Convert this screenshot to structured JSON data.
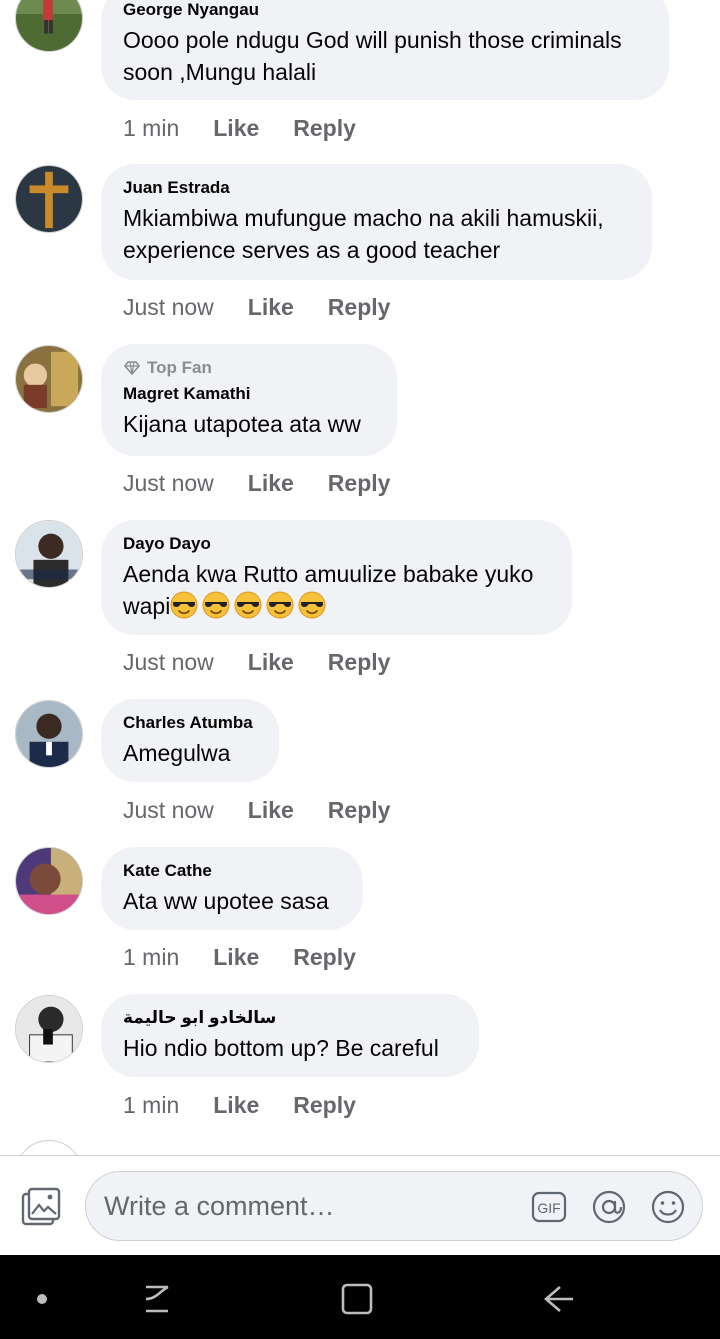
{
  "comments": [
    {
      "name": "George Nyangau",
      "lines": [
        "Oooo pole ndugu God will punish those criminals",
        "soon ,Mungu halali"
      ],
      "time": "1 min",
      "like": "Like",
      "reply": "Reply"
    },
    {
      "name": "Juan Estrada",
      "lines": [
        "Mkiambiwa mufungue macho na akili hamuskii,",
        "experience serves as a good teacher"
      ],
      "time": "Just now",
      "like": "Like",
      "reply": "Reply"
    },
    {
      "badge": "Top Fan",
      "name": "Magret Kamathi",
      "lines": [
        "Kijana utapotea ata ww"
      ],
      "time": "Just now",
      "like": "Like",
      "reply": "Reply"
    },
    {
      "name": "Dayo Dayo",
      "lines": [
        "Aenda kwa Rutto amuulize babake yuko",
        "wapi"
      ],
      "emoji_count": 5,
      "emoji": "smiling-face-with-sunglasses",
      "time": "Just now",
      "like": "Like",
      "reply": "Reply"
    },
    {
      "name": "Charles Atumba",
      "lines": [
        "Amegulwa"
      ],
      "time": "Just now",
      "like": "Like",
      "reply": "Reply"
    },
    {
      "name": "Kate Cathe",
      "lines": [
        "Ata ww upotee sasa"
      ],
      "time": "1 min",
      "like": "Like",
      "reply": "Reply"
    },
    {
      "name": "سالخادو ابو حاليمة",
      "lines": [
        "Hio ndio bottom up? Be careful"
      ],
      "time": "1 min",
      "like": "Like",
      "reply": "Reply"
    }
  ],
  "composer": {
    "placeholder": "Write a comment…",
    "icons": [
      "photo-icon",
      "gif-icon",
      "mention-icon",
      "emoji-icon"
    ],
    "gif_label": "GIF"
  },
  "navbar": {
    "icons": [
      "dot-icon",
      "recent-apps-icon",
      "home-icon",
      "back-icon"
    ]
  },
  "colors": {
    "bubble": "#f0f2f5",
    "meta": "#65676b",
    "name": "#050505",
    "navbar": "#000000"
  }
}
